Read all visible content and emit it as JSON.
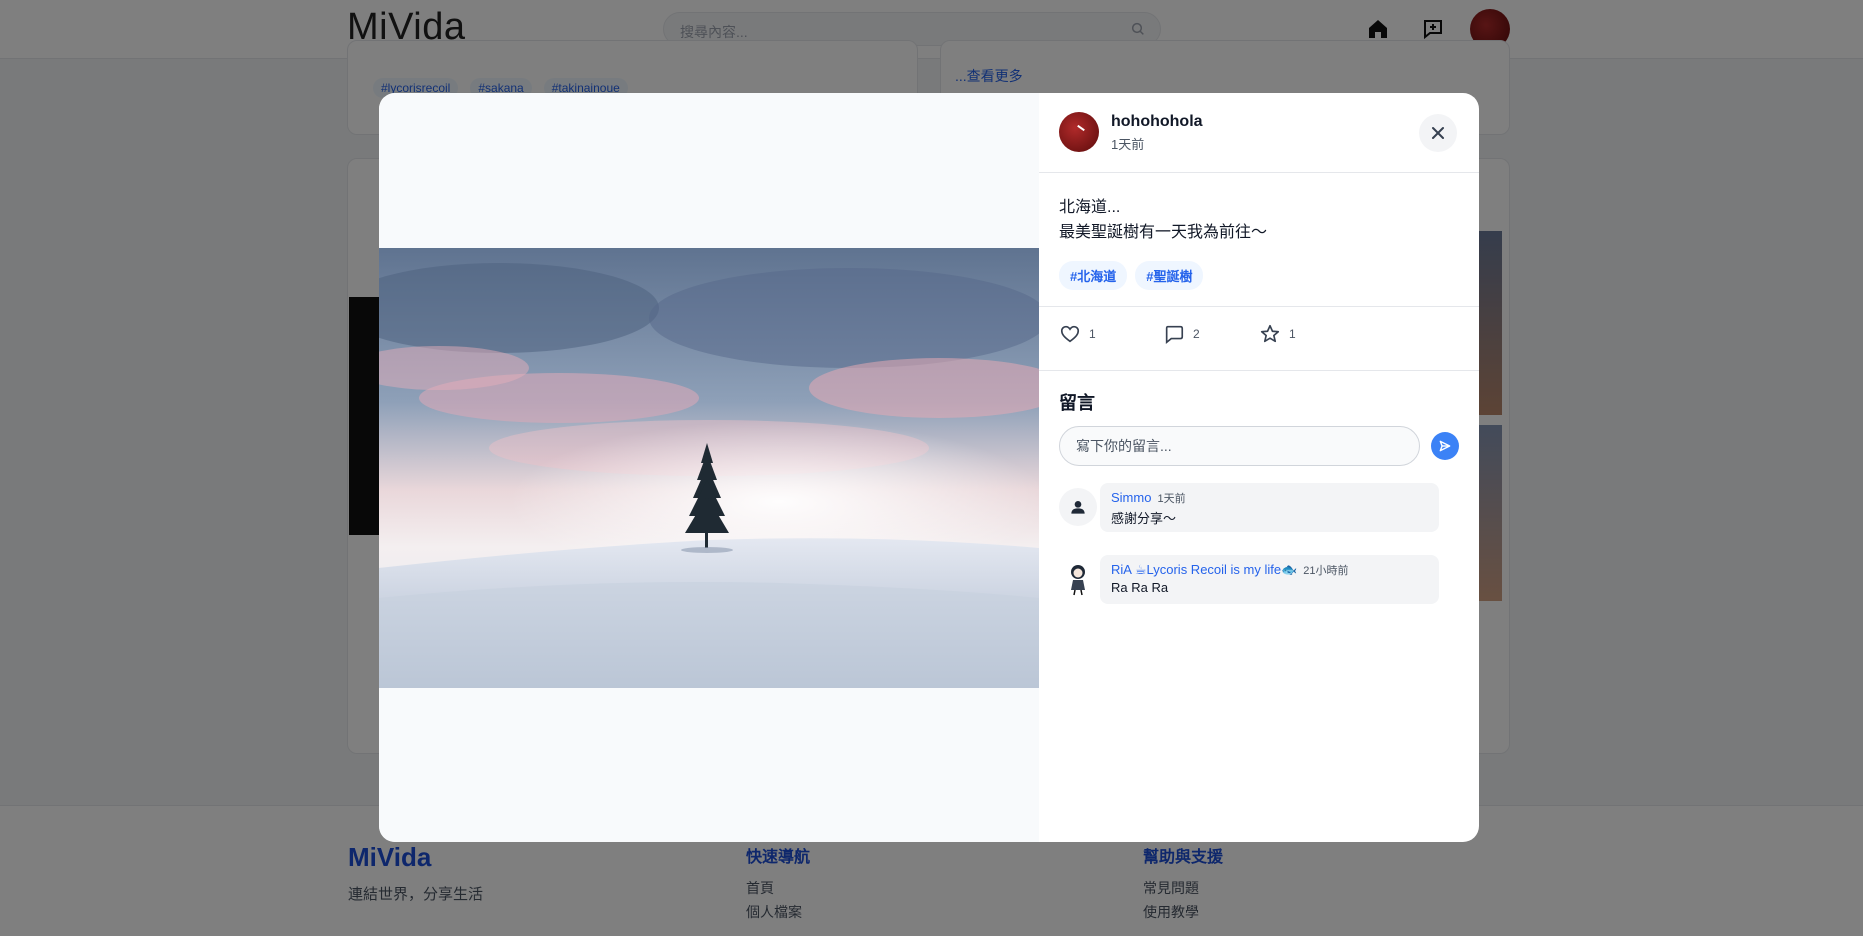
{
  "app": {
    "name": "MiVida"
  },
  "topbar": {
    "logo": "MiVida",
    "search_placeholder": "搜尋內容..."
  },
  "background": {
    "tags": [
      "#lycorisrecoil",
      "#sakana",
      "#takinainoue"
    ],
    "see_more": "...查看更多"
  },
  "footer": {
    "logo": "MiVida",
    "slogan": "連結世界，分享生活",
    "quick_nav_title": "快速導航",
    "quick_nav_links": [
      "首頁",
      "個人檔案"
    ],
    "help_title": "幫助與支援",
    "help_links": [
      "常見問題",
      "使用教學"
    ]
  },
  "post": {
    "author": "hohohohola",
    "time": "1天前",
    "body_line1": "北海道...",
    "body_line2": "最美聖誕樹有一天我為前往～",
    "tags": [
      "#北海道",
      "#聖誕樹"
    ],
    "likes": "1",
    "comments": "2",
    "favorites": "1",
    "image_alt": "snowy field with a lone Christmas tree under a pink sunset sky"
  },
  "comments_section": {
    "title": "留言",
    "input_placeholder": "寫下你的留言...",
    "items": [
      {
        "name": "Simmo",
        "time": "1天前",
        "text": "感謝分享～"
      },
      {
        "name": "RiA ☕Lycoris Recoil is my life🐟",
        "time": "21小時前",
        "text": "Ra Ra Ra"
      }
    ]
  },
  "colors": {
    "accent": "#2563eb",
    "send": "#3b82f6",
    "overlay": "rgba(0,0,0,0.5)"
  }
}
